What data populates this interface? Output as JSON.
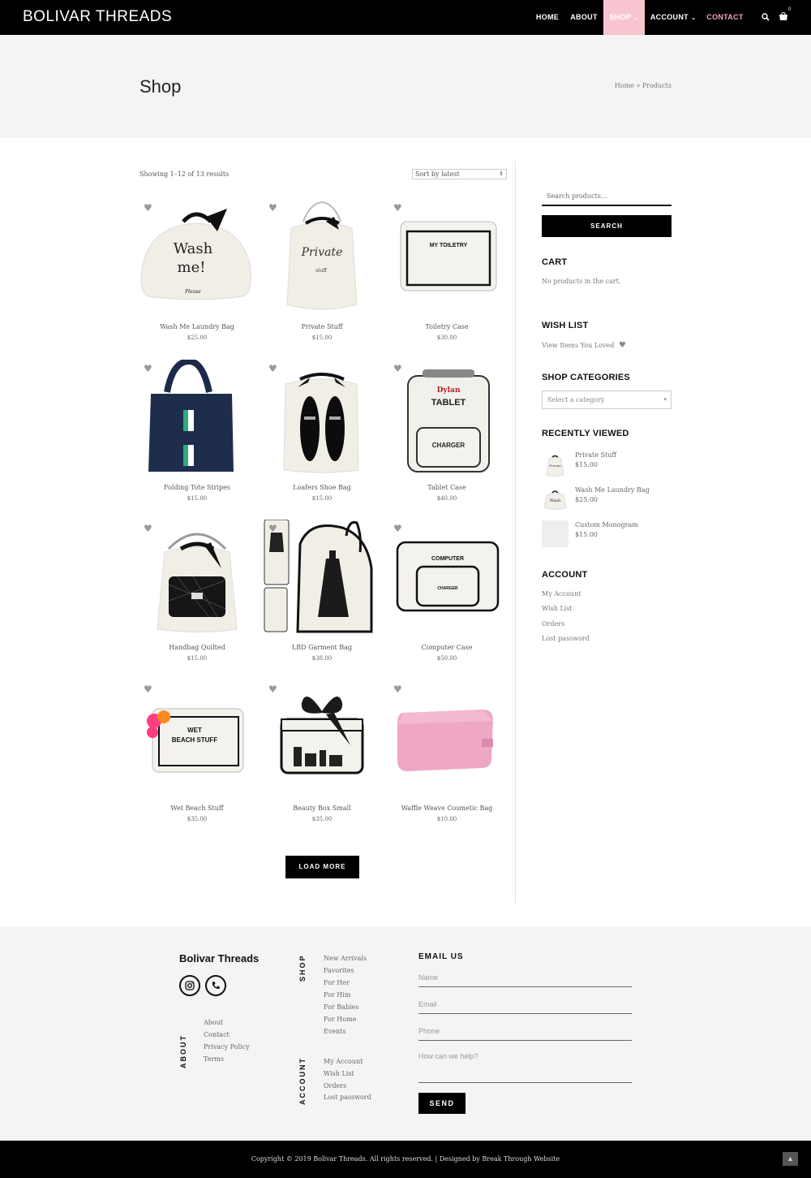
{
  "header": {
    "logo": "BOLIVAR THREADS",
    "nav": [
      "HOME",
      "ABOUT",
      "SHOP",
      "ACCOUNT",
      "CONTACT"
    ],
    "cart_count": "0",
    "colors": {
      "shop_highlight": "#f7c6d0",
      "contact_text": "#f3a7b8"
    }
  },
  "hero": {
    "title": "Shop",
    "breadcrumb": "Home » Products"
  },
  "shop": {
    "result_count": "Showing 1–12 of 13 results",
    "sort": "Sort by latest",
    "products": [
      {
        "name": "Wash Me Laundry Bag",
        "price": "$25.00",
        "art": "laundry"
      },
      {
        "name": "Private Stuff",
        "price": "$15.00",
        "art": "private"
      },
      {
        "name": "Toiletry Case",
        "price": "$30.00",
        "art": "toiletry"
      },
      {
        "name": "Folding Tote Stripes",
        "price": "$15.00",
        "art": "tote"
      },
      {
        "name": "Loafers Shoe Bag",
        "price": "$15.00",
        "art": "loafers"
      },
      {
        "name": "Tablet Case",
        "price": "$40.00",
        "art": "tablet"
      },
      {
        "name": "Handbag Quilted",
        "price": "$15.00",
        "art": "handbag"
      },
      {
        "name": "LBD Garment Bag",
        "price": "$38.00",
        "art": "garment"
      },
      {
        "name": "Computer Case",
        "price": "$50.00",
        "art": "computer"
      },
      {
        "name": "Wet Beach Stuff",
        "price": "$35.00",
        "art": "beach"
      },
      {
        "name": "Beauty Box Small",
        "price": "$35.00",
        "art": "beautybox"
      },
      {
        "name": "Waffle Weave Cosmetic Bag",
        "price": "$10.00",
        "art": "waffle"
      }
    ],
    "art_text": {
      "laundry_1": "Wash",
      "laundry_2": "me!",
      "laundry_3": "Please",
      "private_1": "Private",
      "private_2": "stuff",
      "toiletry": "MY TOILETRY",
      "tablet_1": "Dylan",
      "tablet_2": "TABLET",
      "tablet_3": "CHARGER",
      "computer_1": "COMPUTER",
      "computer_2": "CHARGER",
      "beach_1": "WET",
      "beach_2": "BEACH STUFF"
    },
    "load_more": "LOAD MORE"
  },
  "sidebar": {
    "search_placeholder": "Search products…",
    "search_button": "SEARCH",
    "cart_title": "CART",
    "cart_empty": "No products in the cart.",
    "wishlist_title": "WISH LIST",
    "wishlist_link": "View Items You Loved",
    "categories_title": "SHOP CATEGORIES",
    "categories_select": "Select a category",
    "recent_title": "RECENTLY VIEWED",
    "recent": [
      {
        "name": "Private Stuff",
        "price": "$15.00"
      },
      {
        "name": "Wash Me Laundry Bag",
        "price": "$25.00"
      },
      {
        "name": "Custom Monogram",
        "price": "$15.00"
      }
    ],
    "account_title": "ACCOUNT",
    "account_links": [
      "My Account",
      "Wish List",
      "Orders",
      "Lost password"
    ]
  },
  "footer": {
    "brand": "Bolivar Threads",
    "about_label": "ABOUT",
    "about_links": [
      "About",
      "Contact",
      "Privacy Policy",
      "Terms"
    ],
    "shop_label": "SHOP",
    "shop_links": [
      "New Arrivals",
      "Favorites",
      "For Her",
      "For Him",
      "For Babies",
      "For Home",
      "Events"
    ],
    "account_label": "ACCOUNT",
    "account_links": [
      "My Account",
      "Wish List",
      "Orders",
      "Lost password"
    ],
    "email_title": "EMAIL US",
    "fields": [
      "Name",
      "Email",
      "Phone",
      "How can we help?"
    ],
    "send": "SEND",
    "copyright": "Copyright © 2019 Bolivar Threads. All rights reserved. | Designed by Break Through Website"
  }
}
